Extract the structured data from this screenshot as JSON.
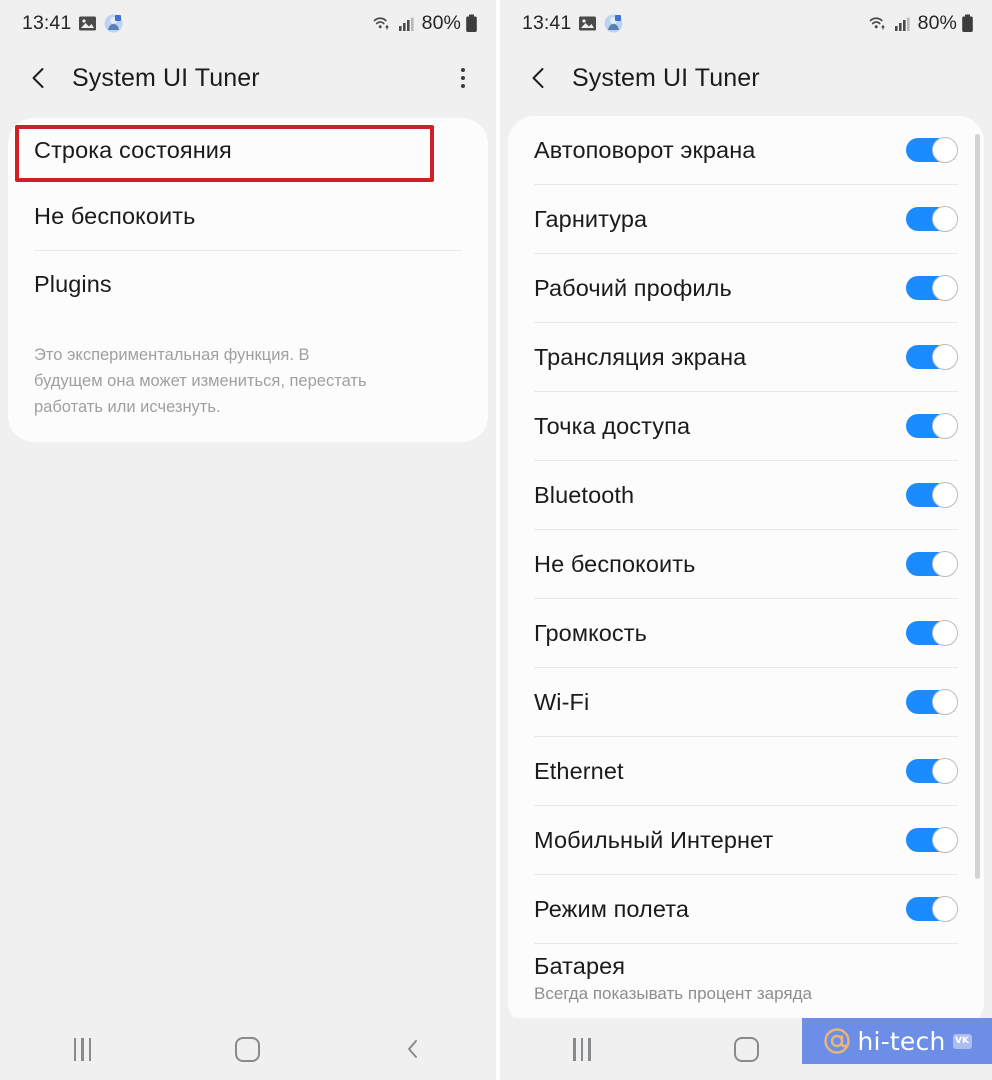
{
  "status_bar": {
    "time": "13:41",
    "battery_percent": "80%",
    "icons": [
      "image-icon",
      "app-notification-icon",
      "wifi-icon",
      "cellular-signal-icon",
      "battery-icon"
    ]
  },
  "left_screen": {
    "app_bar": {
      "title": "System UI Tuner",
      "back_icon": "back-chevron-icon",
      "overflow_icon": "overflow-menu-icon"
    },
    "items": [
      {
        "label": "Строка состояния",
        "highlighted": true
      },
      {
        "label": "Не беспокоить",
        "highlighted": false
      },
      {
        "label": "Plugins",
        "highlighted": false
      }
    ],
    "note": "Это экспериментальная функция. В будущем она может измениться, перестать работать или исчезнуть.",
    "highlight_color": "#cf2027"
  },
  "right_screen": {
    "app_bar": {
      "title": "System UI Tuner",
      "back_icon": "back-chevron-icon"
    },
    "items": [
      {
        "label": "Автоповорот экрана",
        "toggle": "on"
      },
      {
        "label": "Гарнитура",
        "toggle": "on"
      },
      {
        "label": "Рабочий профиль",
        "toggle": "on"
      },
      {
        "label": "Трансляция экрана",
        "toggle": "on"
      },
      {
        "label": "Точка доступа",
        "toggle": "on"
      },
      {
        "label": "Bluetooth",
        "toggle": "on"
      },
      {
        "label": "Не беспокоить",
        "toggle": "on"
      },
      {
        "label": "Громкость",
        "toggle": "on"
      },
      {
        "label": "Wi-Fi",
        "toggle": "on"
      },
      {
        "label": "Ethernet",
        "toggle": "on"
      },
      {
        "label": "Мобильный Интернет",
        "toggle": "on"
      },
      {
        "label": "Режим полета",
        "toggle": "on"
      },
      {
        "label": "Батарея",
        "sublabel": "Всегда показывать процент заряда",
        "toggle": "none"
      }
    ],
    "accent_color": "#1a8cff"
  },
  "nav_bar": {
    "recents_icon": "recents-icon",
    "home_icon": "home-icon",
    "back_icon": "back-icon"
  },
  "watermark": {
    "at_symbol": "@",
    "text": "hi-tech",
    "badge": "VK",
    "background_color": "#6d8ee6"
  }
}
